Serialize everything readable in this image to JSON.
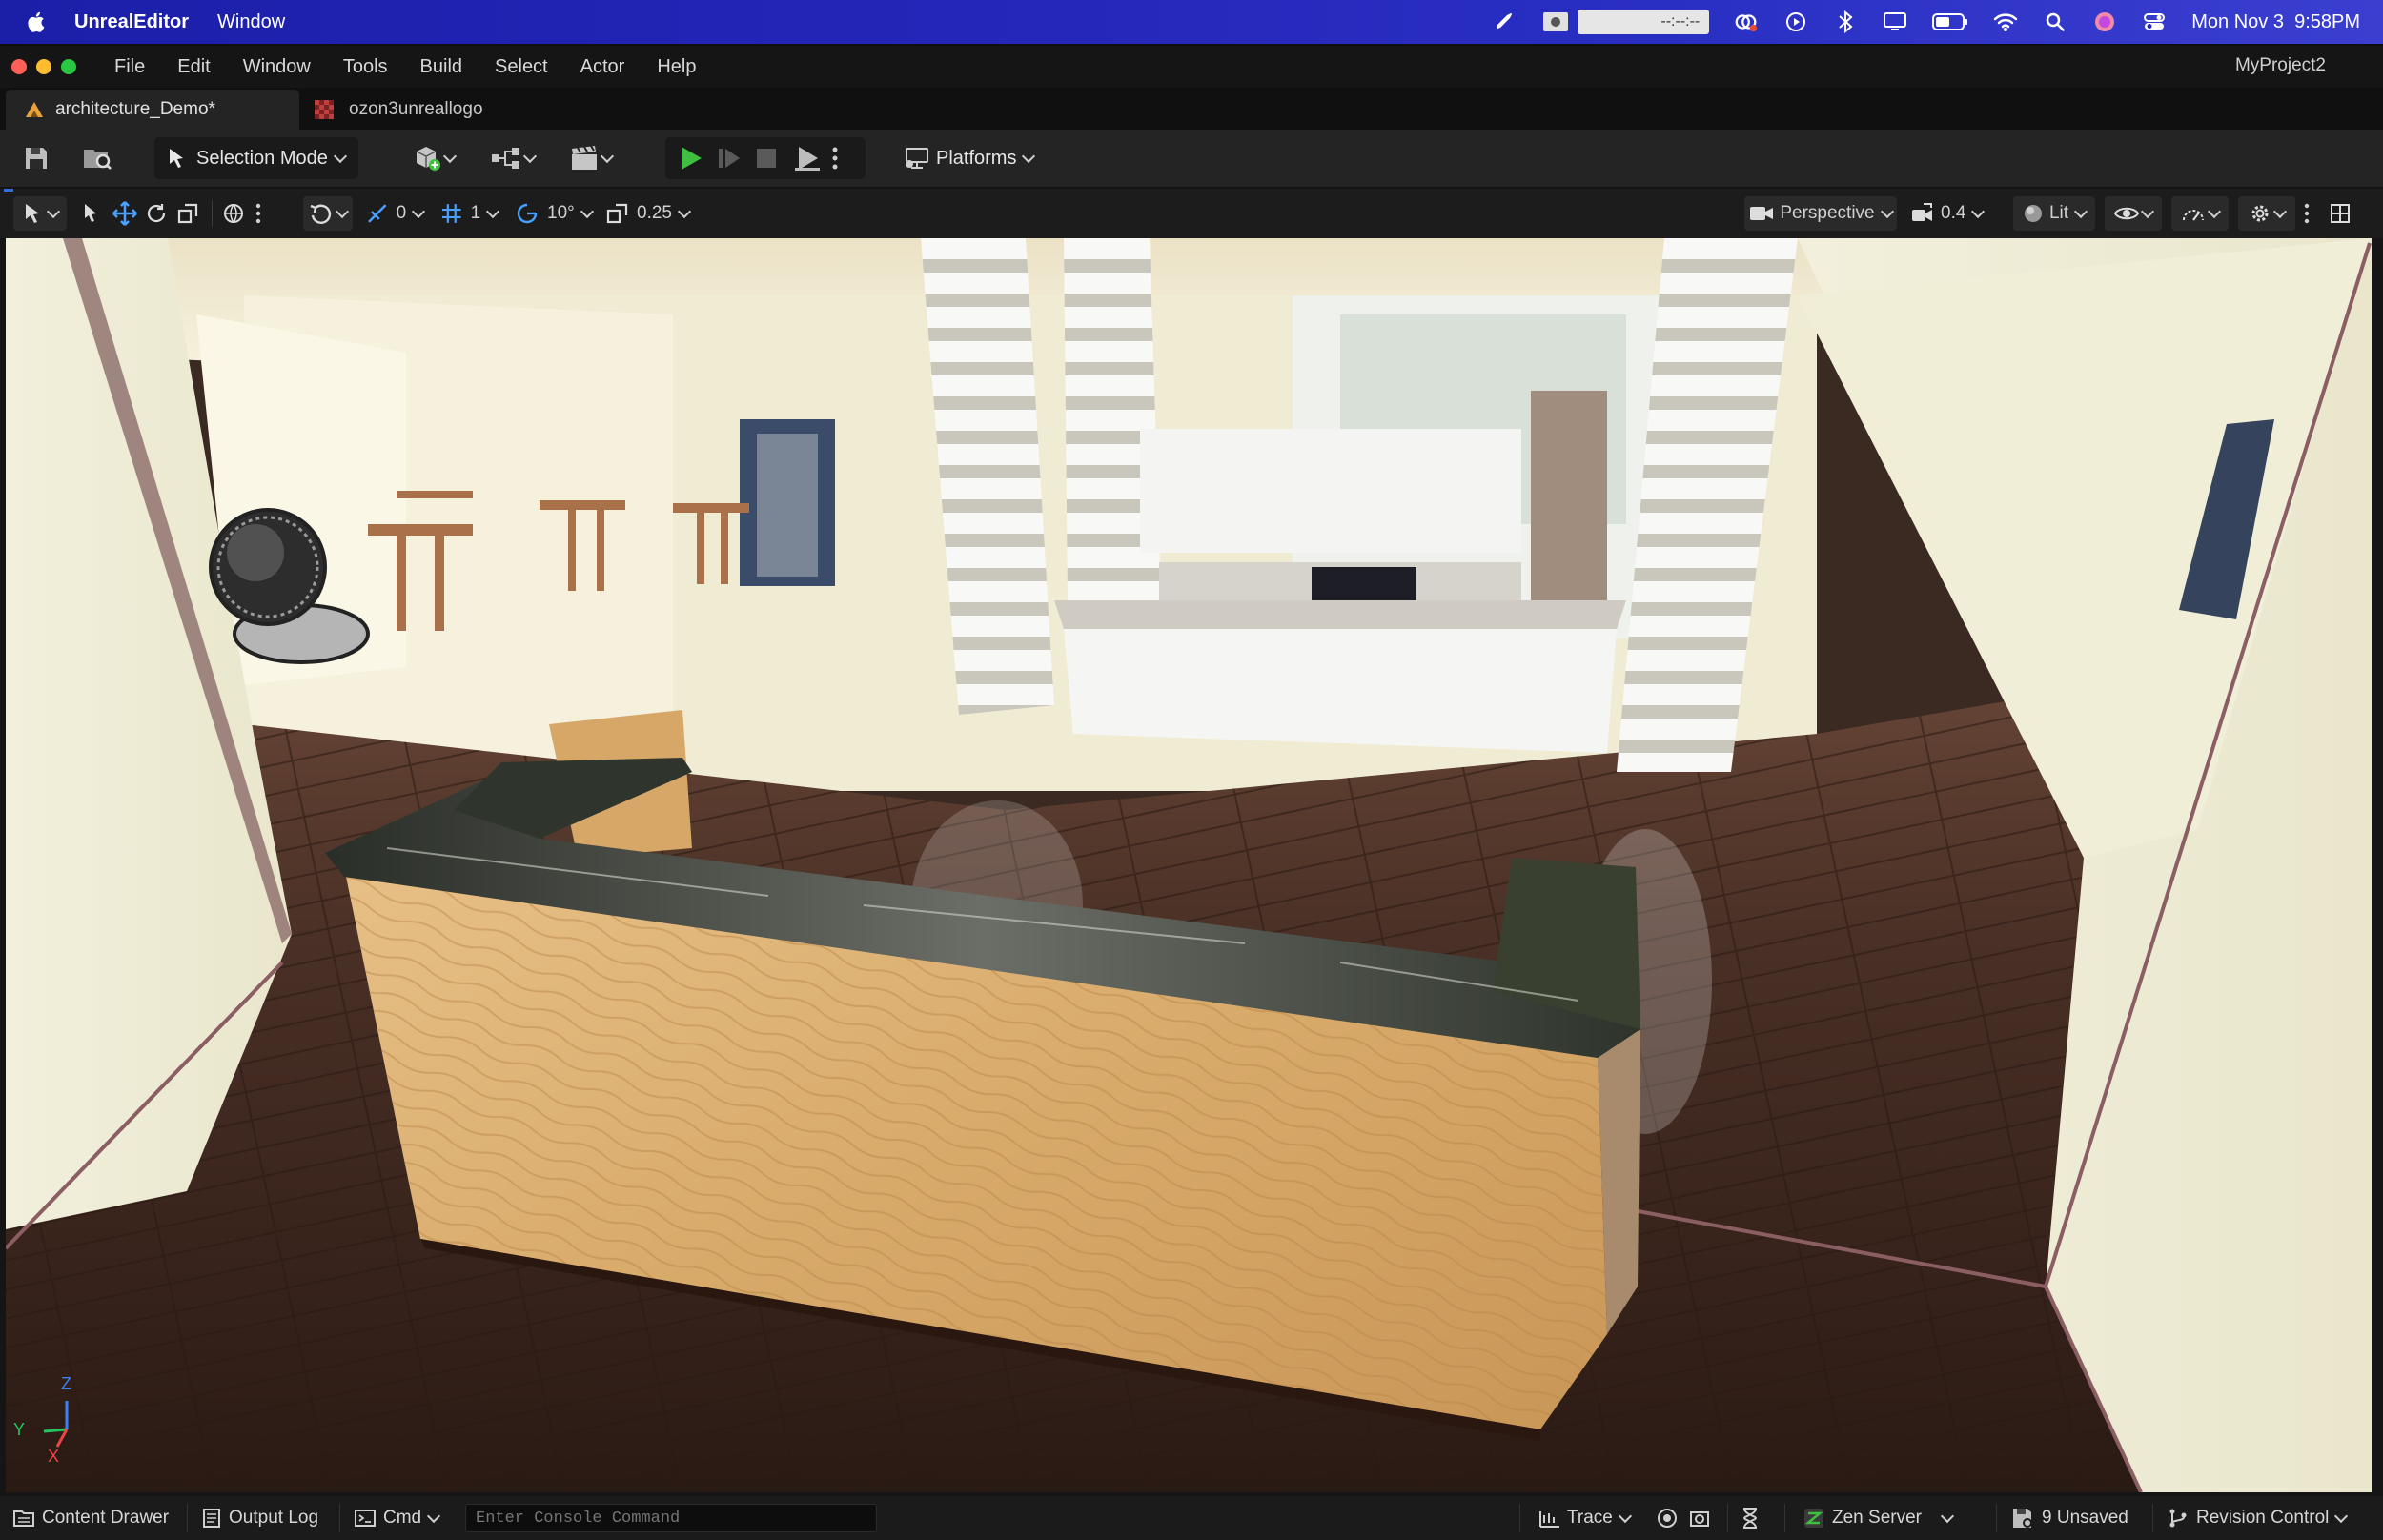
{
  "menubar": {
    "app_name": "UnrealEditor",
    "menu_window": "Window",
    "recording_display": "--:--:--",
    "datetime": "Mon Nov 3  9:58PM"
  },
  "window": {
    "menus": [
      "File",
      "Edit",
      "Window",
      "Tools",
      "Build",
      "Select",
      "Actor",
      "Help"
    ],
    "project_name": "MyProject2",
    "traffic_lights": {
      "close": "#ff5f57",
      "minimize": "#febc2e",
      "zoom": "#28c840"
    }
  },
  "tabs": [
    {
      "label": "architecture_Demo*",
      "active": true
    },
    {
      "label": "ozon3unreallogo",
      "active": false
    }
  ],
  "toolbar": {
    "selection_mode": "Selection Mode",
    "platforms": "Platforms"
  },
  "viewport_toolbar": {
    "surface_snap_value": "0",
    "grid_snap_value": "1",
    "rotation_snap_value": "10°",
    "scale_snap_value": "0.25",
    "view_mode": "Perspective",
    "camera_speed": "0.4",
    "lighting_mode": "Lit"
  },
  "viewport": {
    "axis_labels": {
      "z": "Z",
      "y": "Y",
      "x": "X"
    }
  },
  "statusbar": {
    "content_drawer": "Content Drawer",
    "output_log": "Output Log",
    "cmd": "Cmd",
    "console_placeholder": "Enter Console Command",
    "trace": "Trace",
    "zen_server": "Zen Server",
    "unsaved": "9 Unsaved",
    "revision_control": "Revision Control"
  },
  "colors": {
    "play_green": "#3fbf3f",
    "menubar_blue": "#2326b8",
    "accent_blue": "#2f6fe0"
  }
}
